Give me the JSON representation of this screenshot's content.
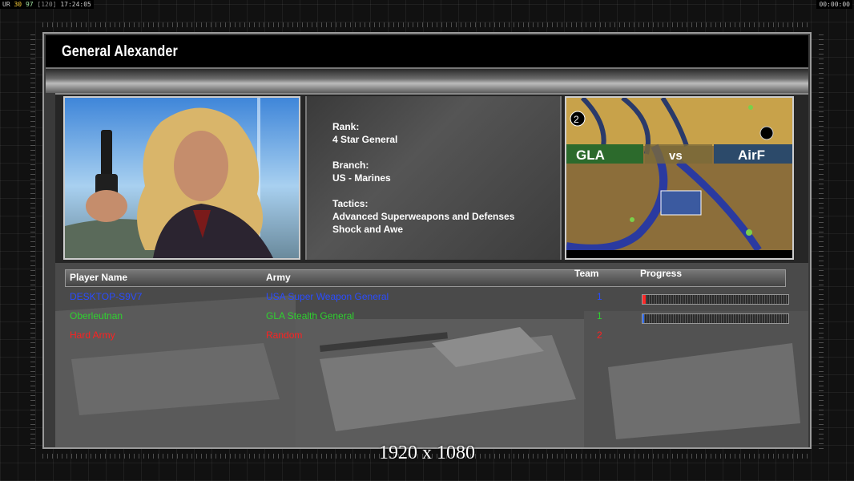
{
  "hud": {
    "left_prefix": "UR",
    "left_value1": "30",
    "left_value2": "97",
    "left_value3": "[120]",
    "left_time": "17:24:05",
    "right_time": "00:00:00"
  },
  "screen": {
    "title": "General Alexander",
    "resolution_label": "1920 x 1080"
  },
  "general": {
    "rank_label": "Rank:",
    "rank_value": "4 Star General",
    "branch_label": "Branch:",
    "branch_value": "US - Marines",
    "tactics_label": "Tactics:",
    "tactics_line1": "Advanced Superweapons and Defenses",
    "tactics_line2": "Shock and Awe"
  },
  "minimap": {
    "player_count": "2",
    "left_team": "GLA",
    "vs_text": "vs",
    "right_team": "AirF"
  },
  "table": {
    "headers": {
      "player": "Player Name",
      "army": "Army",
      "team": "Team",
      "progress": "Progress"
    },
    "rows": [
      {
        "name": "DESKTOP-S9V7",
        "army": "USA Super Weapon General",
        "team": "1",
        "progress": 0.02,
        "color": "#2a4cff"
      },
      {
        "name": "Oberleutnan",
        "army": "GLA Stealth General",
        "team": "1",
        "progress": 0.0,
        "color": "#2fd22f"
      },
      {
        "name": "Hard Army",
        "army": "Random",
        "team": "2",
        "progress": null,
        "color": "#ff2020"
      }
    ]
  },
  "colors": {
    "player1": "#2a4cff",
    "player2": "#2fd22f",
    "player3": "#ff2020"
  }
}
